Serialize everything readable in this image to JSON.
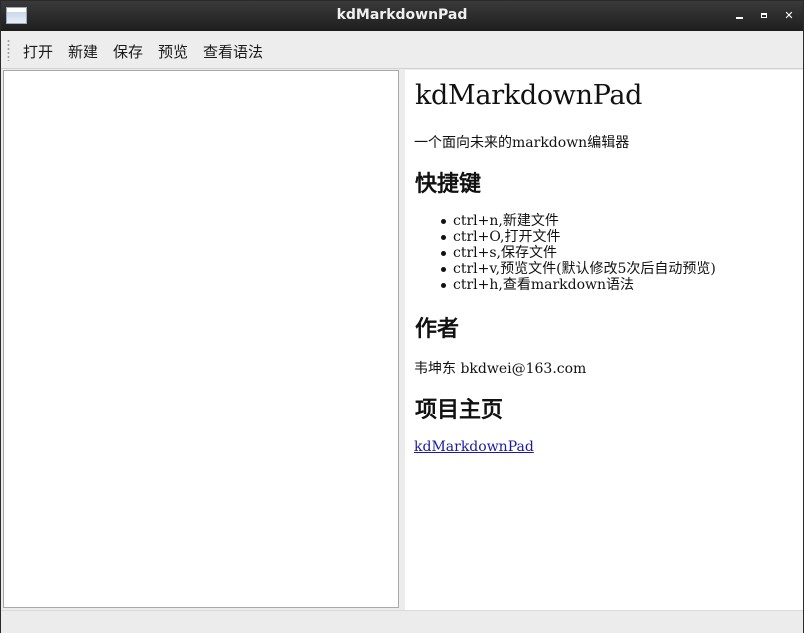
{
  "window": {
    "title": "kdMarkdownPad",
    "icon": "window-app-icon",
    "controls": [
      "minimize-icon",
      "maximize-icon",
      "close-icon"
    ]
  },
  "toolbar": {
    "open_label": "打开",
    "new_label": "新建",
    "save_label": "保存",
    "preview_label": "预览",
    "syntax_label": "查看语法"
  },
  "editor": {
    "content": ""
  },
  "preview": {
    "title": "kdMarkdownPad",
    "subtitle": "一个面向未来的markdown编辑器",
    "shortcuts_heading": "快捷键",
    "shortcuts": [
      "ctrl+n,新建文件",
      "ctrl+O,打开文件",
      "ctrl+s,保存文件",
      "ctrl+v,预览文件(默认修改5次后自动预览)",
      "ctrl+h,查看markdown语法"
    ],
    "author_heading": "作者",
    "author_text": "韦坤东 bkdwei@163.com",
    "homepage_heading": "项目主页",
    "homepage_link": "kdMarkdownPad"
  },
  "colors": {
    "titlebar": "#1e1e1e",
    "link": "#1a1aa6",
    "background": "#ececec"
  }
}
